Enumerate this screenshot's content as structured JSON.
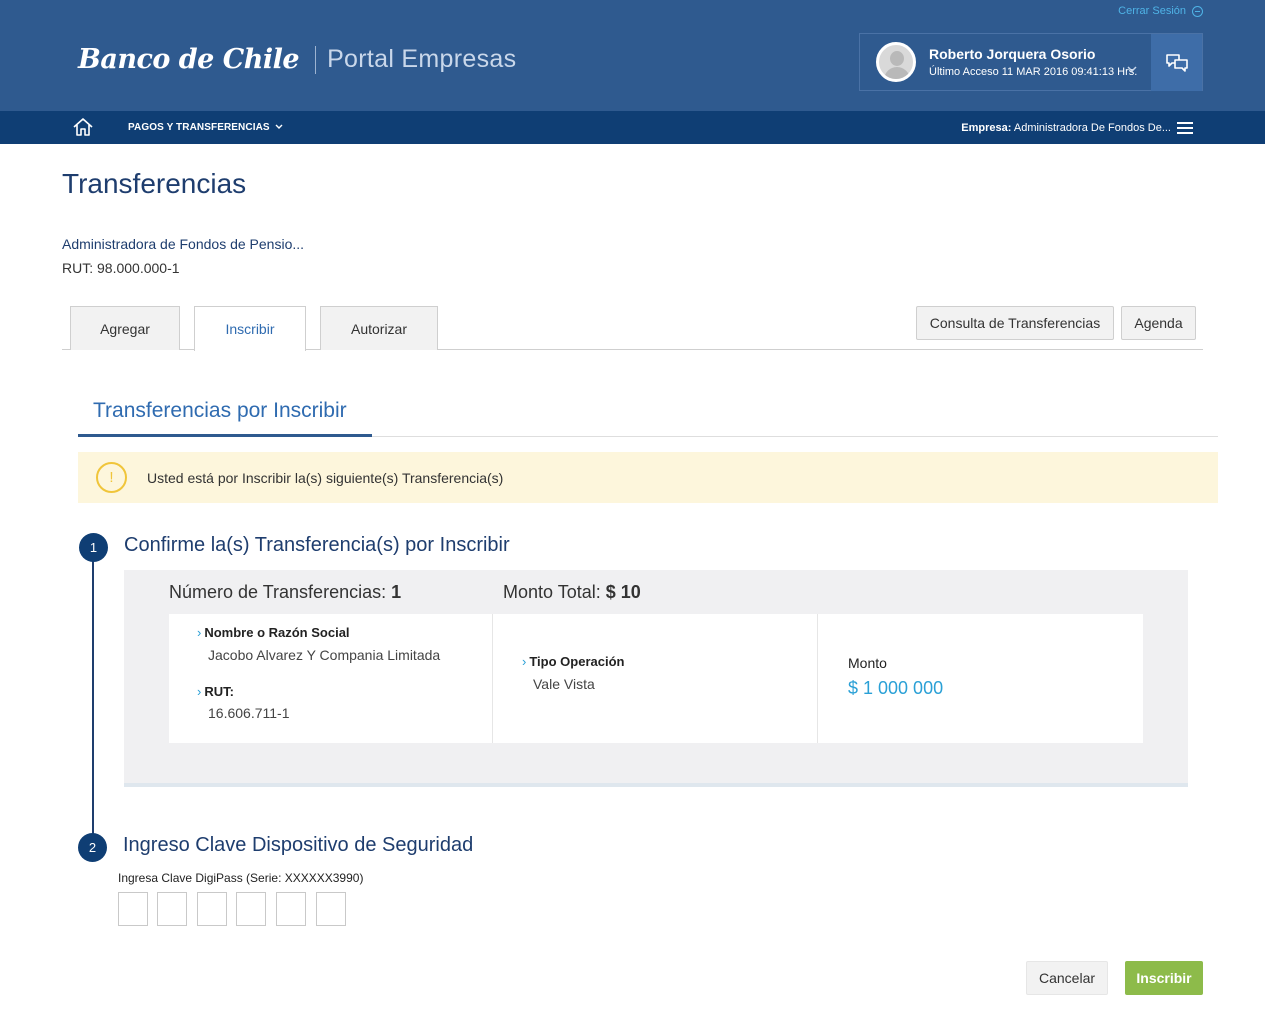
{
  "header": {
    "logout_label": "Cerrar Sesión",
    "brand_bank": "Banco de Chile",
    "brand_portal": "Portal Empresas",
    "user_name": "Roberto Jorquera Osorio",
    "last_access": "Último Acceso 11 MAR 2016 09:41:13 Hrs."
  },
  "navbar": {
    "menu_label": "PAGOS Y TRANSFERENCIAS",
    "company_prefix": "Empresa:",
    "company_name": "Administradora De Fondos De..."
  },
  "page": {
    "title": "Transferencias",
    "company_name": "Administradora de Fondos de Pensio...",
    "rut": "RUT: 98.000.000-1"
  },
  "tabs": [
    {
      "label": "Agregar"
    },
    {
      "label": "Inscribir",
      "active": true
    },
    {
      "label": "Autorizar"
    }
  ],
  "actions": {
    "consulta": "Consulta de Transferencias",
    "agenda": "Agenda"
  },
  "section": {
    "title": "Transferencias por Inscribir"
  },
  "alert": {
    "icon": "!",
    "text": "Usted está por Inscribir la(s) siguiente(s) Transferencia(s)"
  },
  "step1": {
    "number": "1",
    "title": "Confirme la(s) Transferencia(s) por Inscribir",
    "count_label": "Número de Transferencias:",
    "count_value": "1",
    "total_label": "Monto Total:",
    "total_value": "$ 10",
    "nombre_label": "Nombre o Razón Social",
    "nombre_value": "Jacobo Alvarez Y Compania Limitada",
    "rut_label": "RUT:",
    "rut_value": "16.606.711-1",
    "tipo_label": "Tipo Operación",
    "tipo_value": "Vale Vista",
    "monto_label": "Monto",
    "monto_value": "$ 1 000 000"
  },
  "step2": {
    "number": "2",
    "title": "Ingreso Clave Dispositivo de Seguridad",
    "digipass_label": "Ingresa Clave DigiPass (Serie: XXXXXX3990)"
  },
  "buttons": {
    "cancel": "Cancelar",
    "submit": "Inscribir"
  },
  "colors": {
    "header": "#2f5a8f",
    "navbar": "#0f3e74",
    "accent": "#2aa0d6",
    "submit": "#8dbb4a",
    "alert_bg": "#fdf6dc"
  }
}
